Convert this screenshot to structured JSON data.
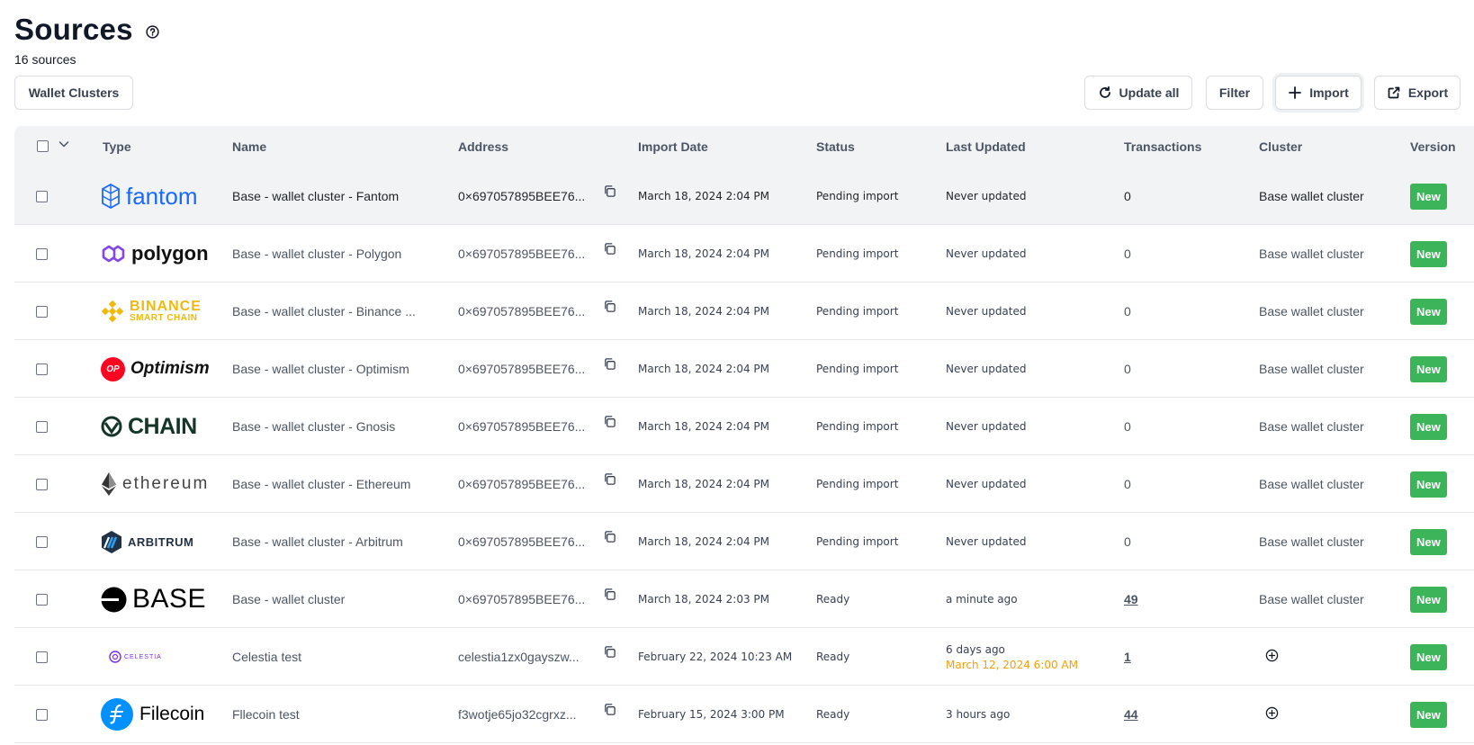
{
  "header": {
    "title": "Sources",
    "count_label": "16 sources"
  },
  "toolbar": {
    "wallet_clusters": "Wallet Clusters",
    "update_all": "Update all",
    "filter": "Filter",
    "import": "Import",
    "export": "Export"
  },
  "columns": {
    "type": "Type",
    "name": "Name",
    "address": "Address",
    "import_date": "Import Date",
    "status": "Status",
    "last_updated": "Last Updated",
    "transactions": "Transactions",
    "cluster": "Cluster",
    "version": "Version"
  },
  "rows": [
    {
      "logo": "fantom",
      "name": "Base - wallet cluster - Fantom",
      "address": "0×697057895BEE76...",
      "import_date": "March 18, 2024 2:04 PM",
      "status": "Pending import",
      "last_updated": "Never updated",
      "last_updated_sub": "",
      "transactions": "0",
      "cluster": "Base wallet cluster",
      "version": "New"
    },
    {
      "logo": "polygon",
      "name": "Base - wallet cluster - Polygon",
      "address": "0×697057895BEE76...",
      "import_date": "March 18, 2024 2:04 PM",
      "status": "Pending import",
      "last_updated": "Never updated",
      "last_updated_sub": "",
      "transactions": "0",
      "cluster": "Base wallet cluster",
      "version": "New"
    },
    {
      "logo": "binance",
      "name": "Base - wallet cluster - Binance ...",
      "address": "0×697057895BEE76...",
      "import_date": "March 18, 2024 2:04 PM",
      "status": "Pending import",
      "last_updated": "Never updated",
      "last_updated_sub": "",
      "transactions": "0",
      "cluster": "Base wallet cluster",
      "version": "New"
    },
    {
      "logo": "optimism",
      "name": "Base - wallet cluster - Optimism",
      "address": "0×697057895BEE76...",
      "import_date": "March 18, 2024 2:04 PM",
      "status": "Pending import",
      "last_updated": "Never updated",
      "last_updated_sub": "",
      "transactions": "0",
      "cluster": "Base wallet cluster",
      "version": "New"
    },
    {
      "logo": "gnosis",
      "name": "Base - wallet cluster - Gnosis",
      "address": "0×697057895BEE76...",
      "import_date": "March 18, 2024 2:04 PM",
      "status": "Pending import",
      "last_updated": "Never updated",
      "last_updated_sub": "",
      "transactions": "0",
      "cluster": "Base wallet cluster",
      "version": "New"
    },
    {
      "logo": "ethereum",
      "name": "Base - wallet cluster - Ethereum",
      "address": "0×697057895BEE76...",
      "import_date": "March 18, 2024 2:04 PM",
      "status": "Pending import",
      "last_updated": "Never updated",
      "last_updated_sub": "",
      "transactions": "0",
      "cluster": "Base wallet cluster",
      "version": "New"
    },
    {
      "logo": "arbitrum",
      "name": "Base - wallet cluster - Arbitrum",
      "address": "0×697057895BEE76...",
      "import_date": "March 18, 2024 2:04 PM",
      "status": "Pending import",
      "last_updated": "Never updated",
      "last_updated_sub": "",
      "transactions": "0",
      "cluster": "Base wallet cluster",
      "version": "New"
    },
    {
      "logo": "base",
      "name": "Base - wallet cluster",
      "address": "0×697057895BEE76...",
      "import_date": "March 18, 2024 2:03 PM",
      "status": "Ready",
      "last_updated": "a minute ago",
      "last_updated_sub": "",
      "transactions": "49",
      "cluster": "Base wallet cluster",
      "version": "New"
    },
    {
      "logo": "celestia",
      "name": "Celestia test",
      "address": "celestia1zx0gayszw...",
      "import_date": "February 22, 2024 10:23 AM",
      "status": "Ready",
      "last_updated": "6 days ago",
      "last_updated_sub": "March 12, 2024 6:00 AM",
      "transactions": "1",
      "cluster": "",
      "version": "New"
    },
    {
      "logo": "filecoin",
      "name": "Fllecoin test",
      "address": "f3wotje65jo32cgrxz...",
      "import_date": "February 15, 2024 3:00 PM",
      "status": "Ready",
      "last_updated": "3 hours ago",
      "last_updated_sub": "",
      "transactions": "44",
      "cluster": "",
      "version": "New"
    }
  ],
  "logos": {
    "fantom": "fantom",
    "polygon": "polygon",
    "binance_top": "BINANCE",
    "binance_bottom": "SMART CHAIN",
    "optimism_badge": "OP",
    "optimism": "Optimism",
    "gnosis": "CHAIN",
    "ethereum": "ethereum",
    "arbitrum": "ARBITRUM",
    "base": "BASE",
    "celestia": "CELESTIA",
    "filecoin": "Filecoin"
  },
  "colors": {
    "badge_green": "#3cb55a",
    "warning_orange": "#f59e0b",
    "header_bg": "#f1f3f5"
  }
}
